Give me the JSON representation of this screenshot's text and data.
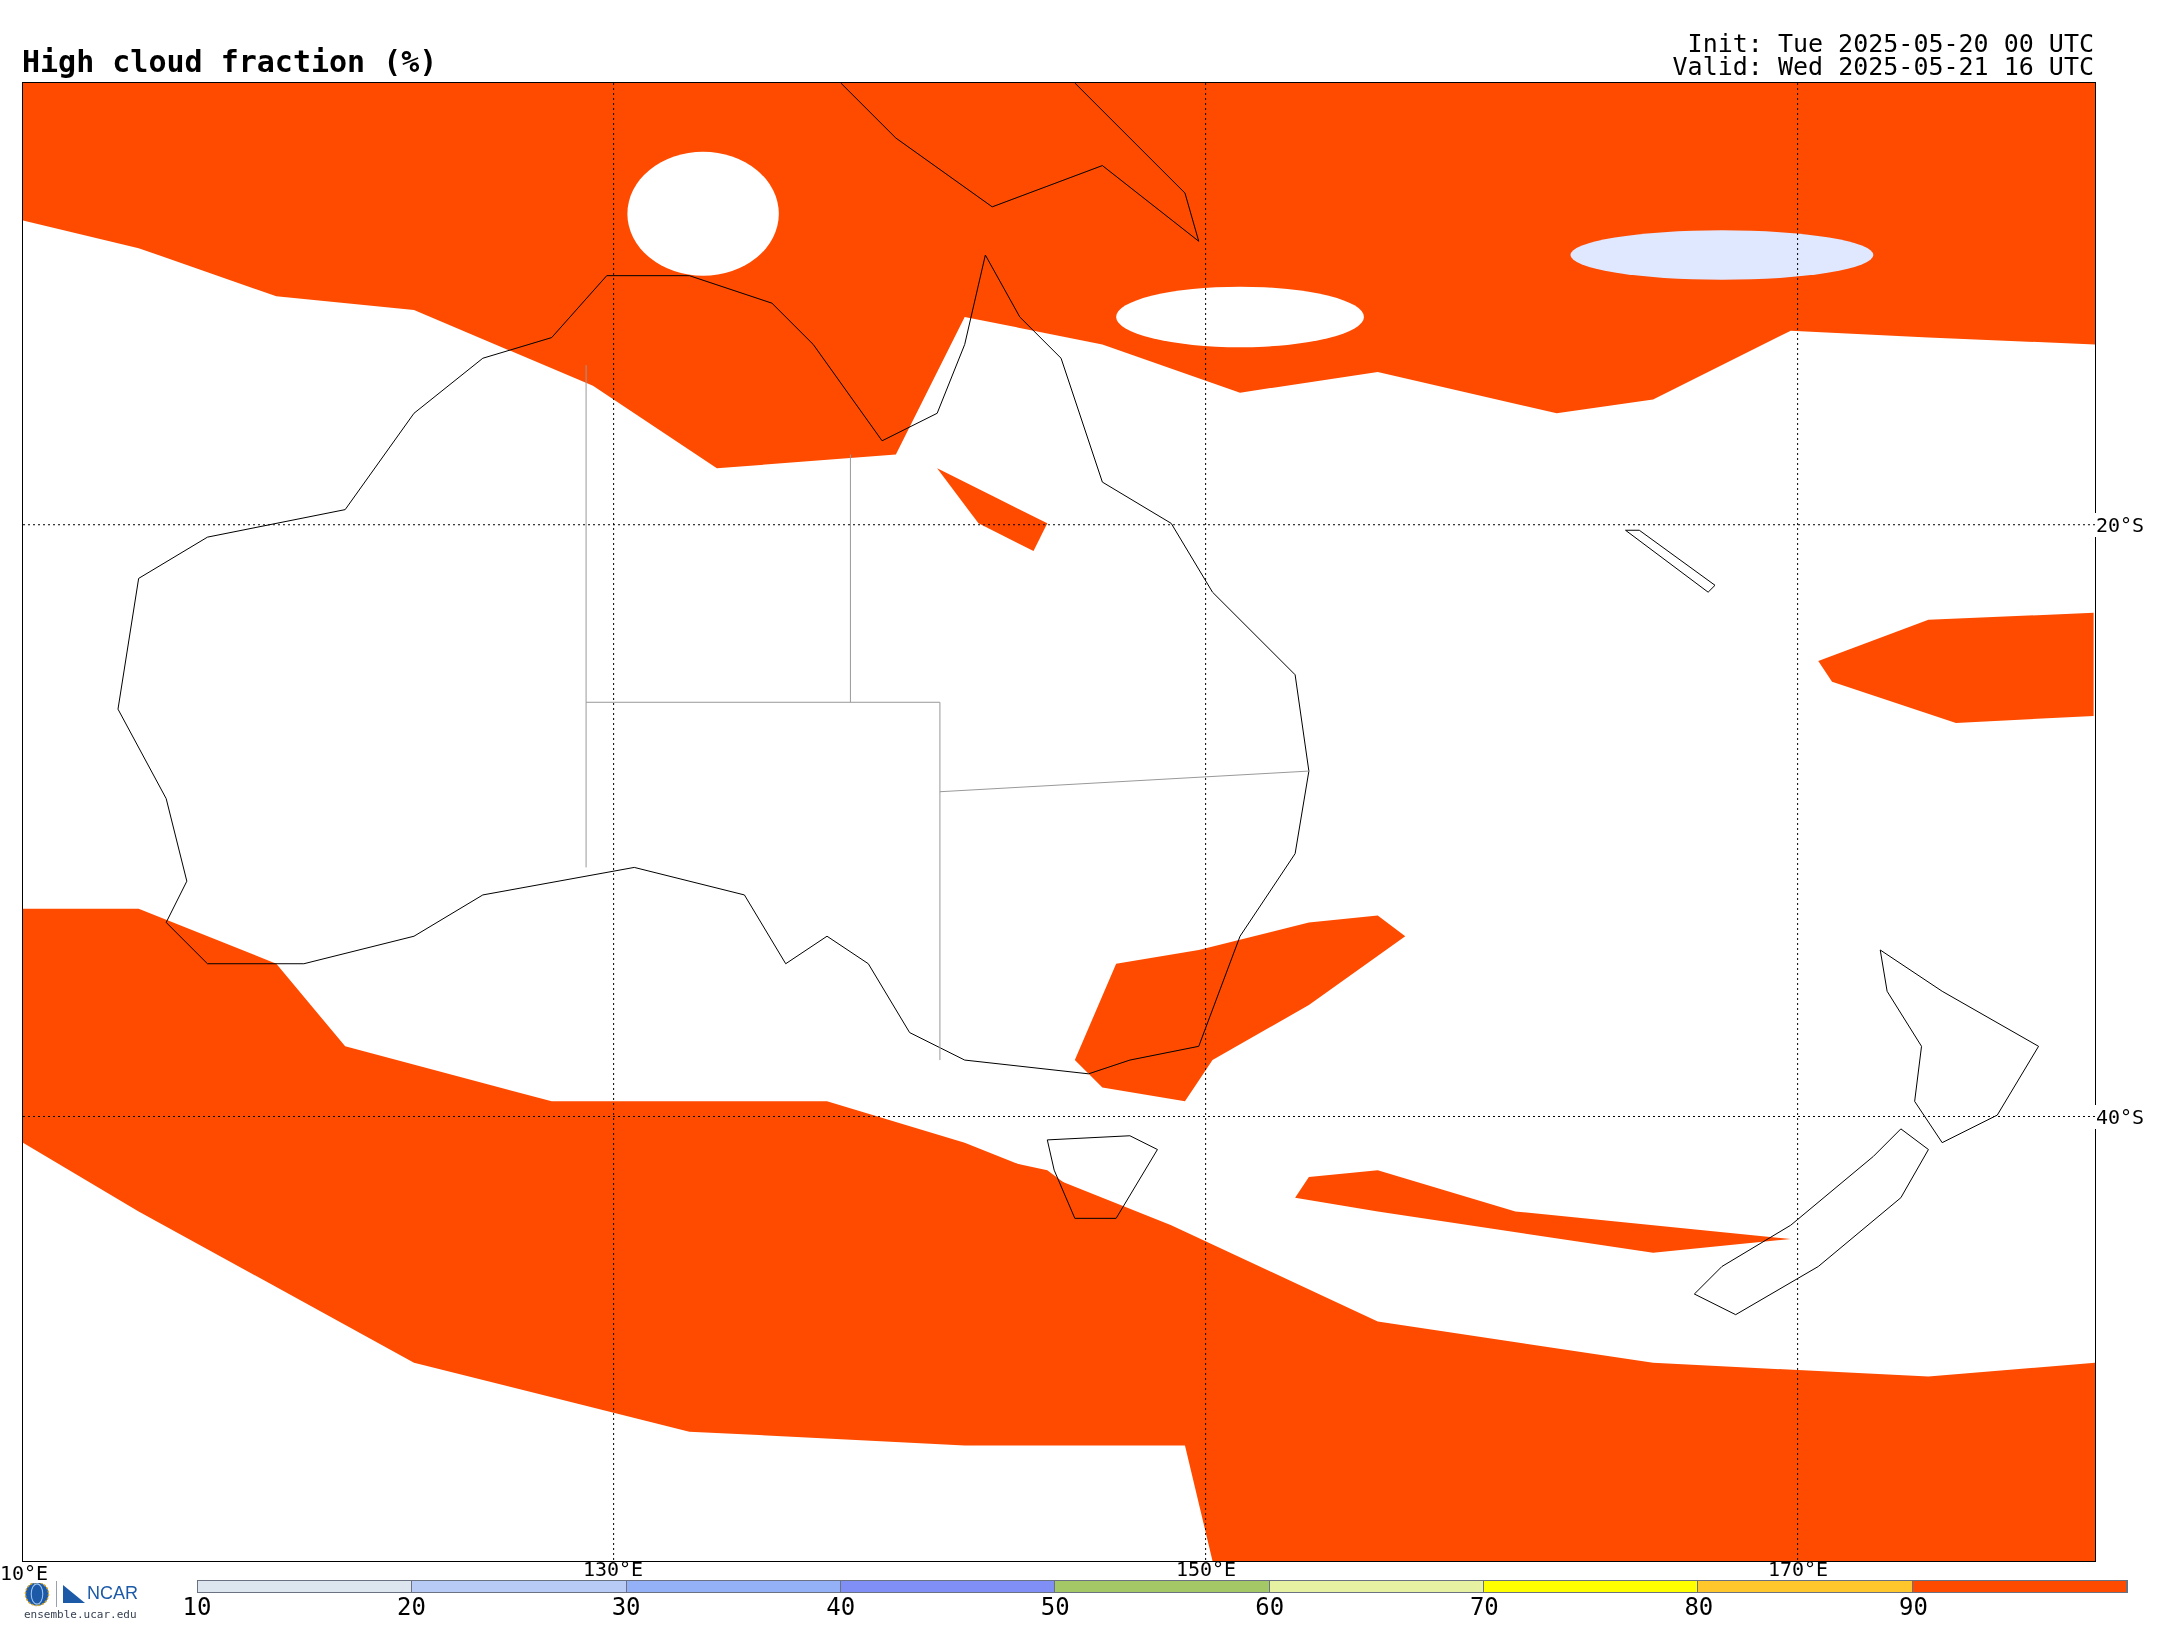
{
  "title": "High cloud fraction (%)",
  "init": "Init: Tue 2025-05-20 00 UTC",
  "valid": "Valid: Wed 2025-05-21 16 UTC",
  "map": {
    "lat_labels": [
      "20°S",
      "40°S"
    ],
    "lon_labels": [
      "10°E",
      "130°E",
      "150°E",
      "170°E"
    ]
  },
  "logo": {
    "name": "NCAR",
    "url": "ensemble.ucar.edu"
  },
  "colorbar": [
    {
      "label": "10",
      "color": "#dde6ee"
    },
    {
      "label": "20",
      "color": "#b8cbf6"
    },
    {
      "label": "30",
      "color": "#94b0f6"
    },
    {
      "label": "40",
      "color": "#7f8ff5"
    },
    {
      "label": "50",
      "color": "#a4c866"
    },
    {
      "label": "60",
      "color": "#e6f2a2"
    },
    {
      "label": "70",
      "color": "#ffff00"
    },
    {
      "label": "80",
      "color": "#ffc72c"
    },
    {
      "label": "90",
      "color": "#ff4b00"
    }
  ]
}
